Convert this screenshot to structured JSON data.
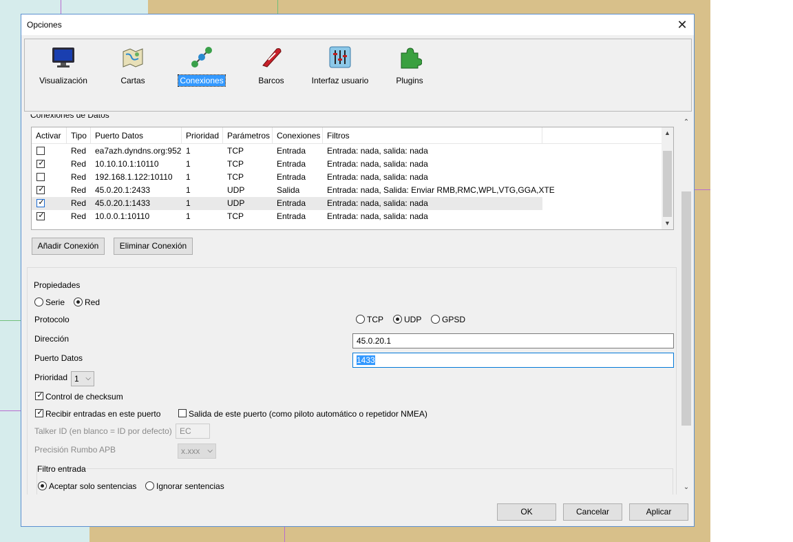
{
  "dialog": {
    "title": "Opciones",
    "close_glyph": "✕"
  },
  "toolbar": {
    "items": [
      {
        "label": "Visualización",
        "icon": "monitor-icon"
      },
      {
        "label": "Cartas",
        "icon": "charts-icon"
      },
      {
        "label": "Conexiones",
        "icon": "connections-icon",
        "selected": true
      },
      {
        "label": "Barcos",
        "icon": "ship-icon"
      },
      {
        "label": "Interfaz usuario",
        "icon": "sliders-icon"
      },
      {
        "label": "Plugins",
        "icon": "puzzle-icon"
      }
    ]
  },
  "connections": {
    "section_label": "Conexiones de Datos",
    "columns": [
      "Activar",
      "Tipo",
      "Puerto Datos",
      "Prioridad",
      "Parámetros",
      "Conexiones",
      "Filtros"
    ],
    "rows": [
      {
        "enabled": false,
        "tipo": "Red",
        "puerto": "ea7azh.dyndns.org:952",
        "prioridad": "1",
        "parametros": "TCP",
        "conexiones": "Entrada",
        "filtros": "Entrada: nada, salida: nada"
      },
      {
        "enabled": true,
        "tipo": "Red",
        "puerto": "10.10.10.1:10110",
        "prioridad": "1",
        "parametros": "TCP",
        "conexiones": "Entrada",
        "filtros": "Entrada: nada, salida: nada"
      },
      {
        "enabled": false,
        "tipo": "Red",
        "puerto": "192.168.1.122:10110",
        "prioridad": "1",
        "parametros": "TCP",
        "conexiones": "Entrada",
        "filtros": "Entrada: nada, salida: nada"
      },
      {
        "enabled": true,
        "tipo": "Red",
        "puerto": "45.0.20.1:2433",
        "prioridad": "1",
        "parametros": "UDP",
        "conexiones": "Salida",
        "filtros": "Entrada: nada, Salida: Enviar RMB,RMC,WPL,VTG,GGA,XTE"
      },
      {
        "enabled": true,
        "tipo": "Red",
        "puerto": "45.0.20.1:1433",
        "prioridad": "1",
        "parametros": "UDP",
        "conexiones": "Entrada",
        "filtros": "Entrada: nada, salida: nada",
        "selected": true
      },
      {
        "enabled": true,
        "tipo": "Red",
        "puerto": "10.0.0.1:10110",
        "prioridad": "1",
        "parametros": "TCP",
        "conexiones": "Entrada",
        "filtros": "Entrada: nada, salida: nada"
      }
    ],
    "add_button": "Añadir Conexión",
    "remove_button": "Eliminar Conexión"
  },
  "properties": {
    "label": "Propiedades",
    "serie_label": "Serie",
    "red_label": "Red",
    "protocolo_label": "Protocolo",
    "tcp_label": "TCP",
    "udp_label": "UDP",
    "gpsd_label": "GPSD",
    "direccion_label": "Dirección",
    "direccion_value": "45.0.20.1",
    "puerto_label": "Puerto Datos",
    "puerto_value": "1433",
    "prioridad_label": "Prioridad",
    "prioridad_value": "1",
    "checksum_label": "Control de checksum",
    "recibir_label": "Recibir entradas en este puerto",
    "salida_label": "Salida de este puerto (como piloto automático o repetidor NMEA)",
    "talker_label": "Talker ID (en blanco = ID por defecto)",
    "talker_value": "EC",
    "precision_label": "Precisión Rumbo APB",
    "precision_value": "x.xxx",
    "filtro_label": "Filtro entrada",
    "aceptar_label": "Aceptar solo sentencias",
    "ignorar_label": "Ignorar sentencias",
    "ellipsis": "..."
  },
  "footer": {
    "ok": "OK",
    "cancel": "Cancelar",
    "apply": "Aplicar"
  }
}
